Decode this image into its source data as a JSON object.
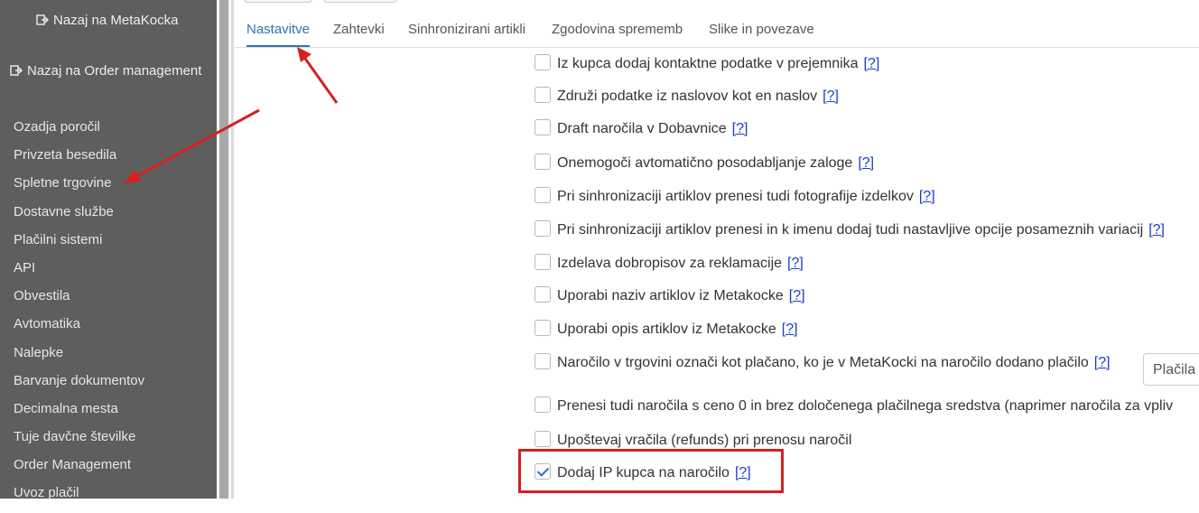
{
  "sidebar": {
    "back_metakocka": "Nazaj na MetaKocka",
    "back_order_management": "Nazaj na Order management",
    "items": [
      {
        "label": "Ozadja poročil"
      },
      {
        "label": "Privzeta besedila"
      },
      {
        "label": "Spletne trgovine"
      },
      {
        "label": "Dostavne službe"
      },
      {
        "label": "Plačilni sistemi"
      },
      {
        "label": "API"
      },
      {
        "label": "Obvestila"
      },
      {
        "label": "Avtomatika"
      },
      {
        "label": "Nalepke"
      },
      {
        "label": "Barvanje dokumentov"
      },
      {
        "label": "Decimalna mesta"
      },
      {
        "label": "Tuje davčne številke"
      },
      {
        "label": "Order Management"
      },
      {
        "label": "Uvoz plačil"
      }
    ]
  },
  "tabs": [
    {
      "label": "Nastavitve",
      "active": true
    },
    {
      "label": "Zahtevki",
      "active": false
    },
    {
      "label": "Sinhronizirani artikli",
      "active": false
    },
    {
      "label": "Zgodovina sprememb",
      "active": false
    },
    {
      "label": "Slike in povezave",
      "active": false
    }
  ],
  "help_label": "[?]",
  "options": [
    {
      "label": "Iz kupca dodaj kontaktne podatke v prejemnika",
      "checked": false
    },
    {
      "label": "Združi podatke iz naslovov kot en naslov",
      "checked": false
    },
    {
      "label": "Draft naročila v Dobavnice",
      "checked": false
    },
    {
      "label": "Onemogoči avtomatično posodabljanje zaloge",
      "checked": false
    },
    {
      "label": "Pri sinhronizaciji artiklov prenesi tudi fotografije izdelkov",
      "checked": false
    },
    {
      "label": "Pri sinhronizaciji artiklov prenesi in k imenu dodaj tudi nastavljive opcije posameznih variacij",
      "checked": false
    },
    {
      "label": "Izdelava dobropisov za reklamacije",
      "checked": false
    },
    {
      "label": "Uporabi naziv artiklov iz Metakocke",
      "checked": false
    },
    {
      "label": "Uporabi opis artiklov iz Metakocke",
      "checked": false
    },
    {
      "label": "Naročilo v trgovini označi kot plačano, ko je v MetaKocki na naročilo dodano plačilo",
      "checked": false
    },
    {
      "label": "Prenesi tudi naročila s ceno 0 in brez določenega plačilnega sredstva (naprimer naročila za vpliv",
      "checked": false
    },
    {
      "label": "Upoštevaj vračila (refunds) pri prenosu naročil",
      "checked": false
    },
    {
      "label": "Dodaj IP kupca na naročilo",
      "checked": true
    }
  ],
  "payment_select": {
    "value": "Plačila"
  },
  "colors": {
    "sidebar_bg": "#5e5e5e",
    "active_tab": "#2b74b8",
    "help_link": "#1a3ec8",
    "annotation_red": "#d62020"
  }
}
